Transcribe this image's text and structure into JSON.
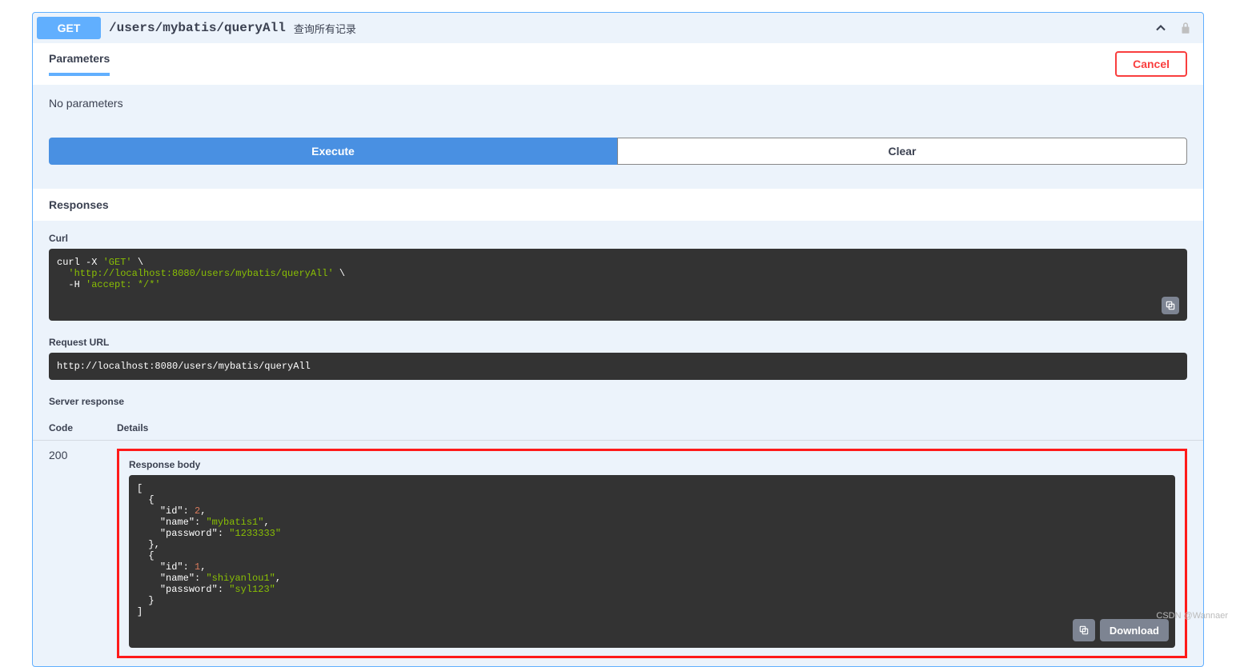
{
  "operation": {
    "method": "GET",
    "path": "/users/mybatis/queryAll",
    "description": "查询所有记录"
  },
  "tabs": {
    "parameters": "Parameters",
    "cancel": "Cancel"
  },
  "params": {
    "empty_message": "No parameters",
    "execute": "Execute",
    "clear": "Clear"
  },
  "responses": {
    "header": "Responses",
    "curl_label": "Curl",
    "curl_content": "curl -X 'GET' \\\n  'http://localhost:8080/users/mybatis/queryAll' \\\n  -H 'accept: */*'",
    "request_url_label": "Request URL",
    "request_url": "http://localhost:8080/users/mybatis/queryAll",
    "server_response_label": "Server response",
    "col_code": "Code",
    "col_details": "Details",
    "code": "200",
    "response_body_label": "Response body",
    "download": "Download",
    "body": [
      {
        "id": 2,
        "name": "mybatis1",
        "password": "1233333"
      },
      {
        "id": 1,
        "name": "shiyanlou1",
        "password": "syl123"
      }
    ]
  },
  "watermark": "CSDN @Wannaer"
}
